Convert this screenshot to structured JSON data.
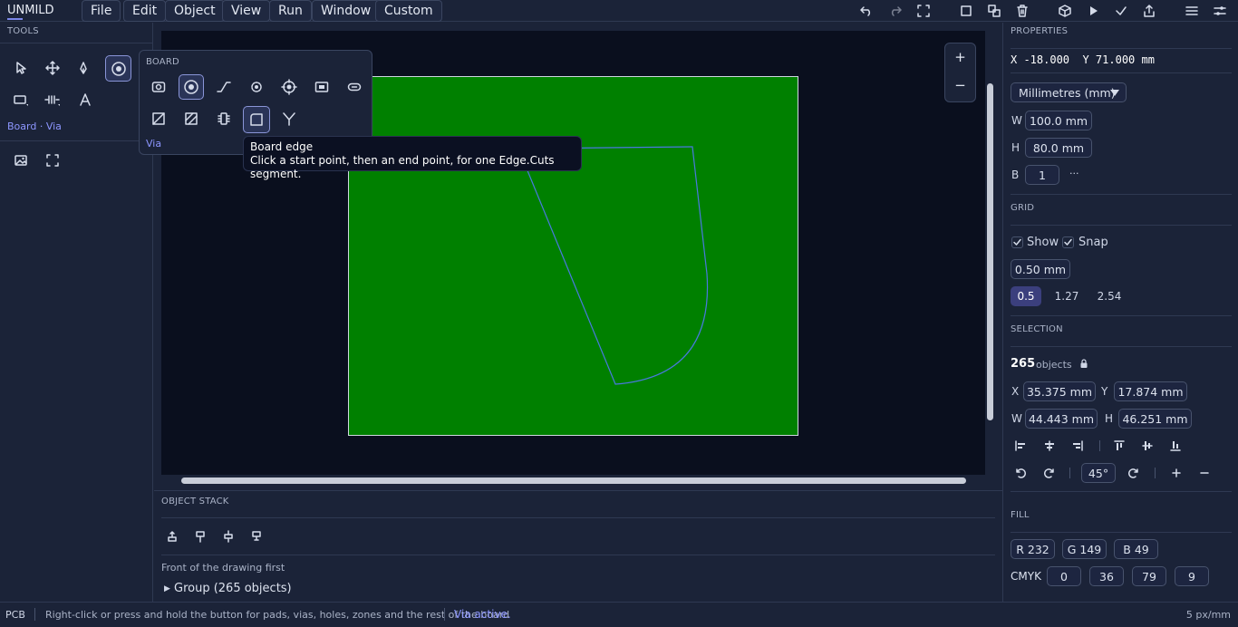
{
  "app": {
    "title": "UNMILD"
  },
  "menu": [
    "File",
    "Edit",
    "Object",
    "View",
    "Run",
    "Window",
    "Custom"
  ],
  "tools": {
    "header": "TOOLS",
    "status": "Board · Via"
  },
  "palette": {
    "header": "BOARD",
    "current": "Via"
  },
  "tooltip": {
    "title": "Board edge",
    "text": "Click a start point, then an end point, for one Edge.Cuts segment."
  },
  "canvas": {
    "board_color": "#008000",
    "edge_color": "#4169e1",
    "background": "#0a0f1e"
  },
  "zoom": {
    "plus": "+",
    "minus": "−"
  },
  "object_stack": {
    "header": "OBJECT STACK",
    "caption": "Front of the drawing first",
    "group": "Group (265 objects)"
  },
  "properties": {
    "header": "PROPERTIES",
    "cursor": "X -18.000  Y 71.000 mm",
    "units": "Millimetres (mm)",
    "w_label": "W",
    "w": "100.0 mm",
    "h_label": "H",
    "h": "80.0 mm",
    "b_label": "B",
    "b": "1",
    "more": "···"
  },
  "grid": {
    "header": "GRID",
    "show": "Show",
    "snap": "Snap",
    "size": "0.50 mm",
    "presets": [
      "0.5",
      "1.27",
      "2.54"
    ]
  },
  "selection": {
    "header": "SELECTION",
    "count": "265",
    "count_label": "objects",
    "x_label": "X",
    "x": "35.375 mm",
    "y_label": "Y",
    "y": "17.874 mm",
    "w_label": "W",
    "w": "44.443 mm",
    "h_label": "H",
    "h": "46.251 mm",
    "angle": "45°"
  },
  "fill": {
    "header": "FILL",
    "r": "R 232",
    "g": "G 149",
    "b": "B 49",
    "cmyk_label": "CMYK",
    "c": "0",
    "m": "36",
    "y": "79",
    "k": "9"
  },
  "statusbar": {
    "mode": "PCB",
    "hint": "Right-click or press and hold the button for pads, vias, holes, zones and the rest of the board",
    "active": "Via active.",
    "scale": "5 px/mm"
  }
}
